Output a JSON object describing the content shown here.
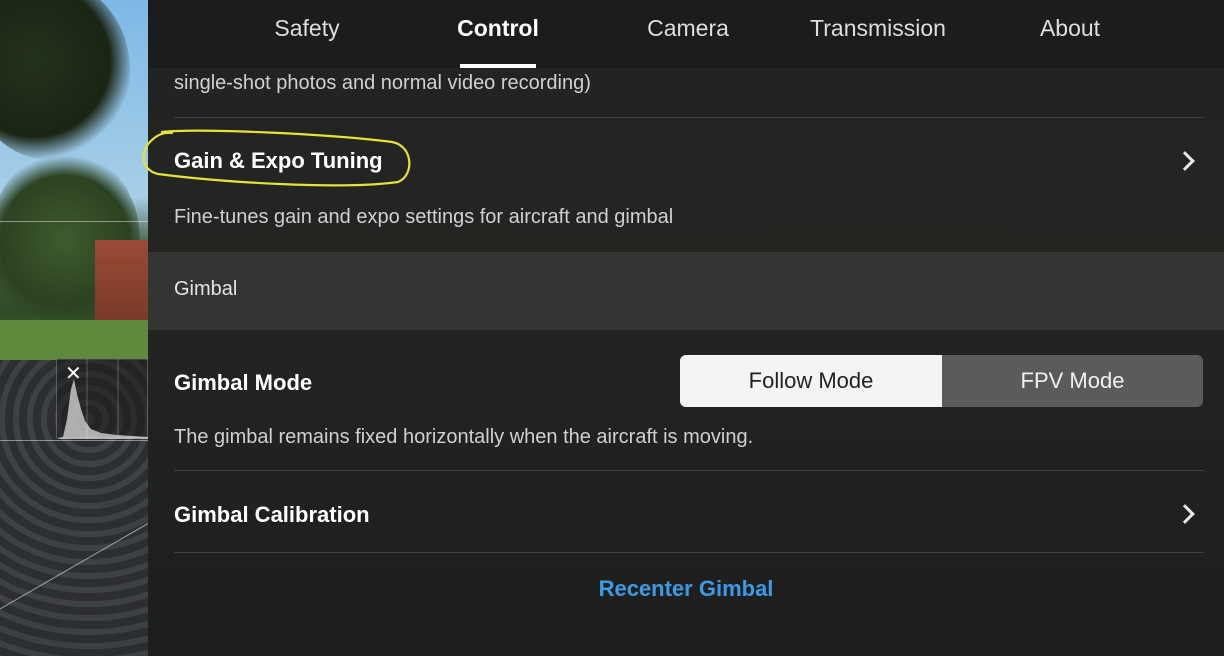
{
  "tabs": [
    {
      "label": "Safety",
      "active": false
    },
    {
      "label": "Control",
      "active": true
    },
    {
      "label": "Camera",
      "active": false
    },
    {
      "label": "Transmission",
      "active": false
    },
    {
      "label": "About",
      "active": false
    }
  ],
  "photo_note": "single-shot photos and normal video recording)",
  "gain_expo": {
    "title": "Gain & Expo Tuning",
    "description": "Fine-tunes gain and expo settings for aircraft and gimbal",
    "icon": "chevron-right-icon"
  },
  "gimbal_section": {
    "label": "Gimbal"
  },
  "gimbal_mode": {
    "title": "Gimbal Mode",
    "options": [
      "Follow Mode",
      "FPV Mode"
    ],
    "selected": "Follow Mode",
    "description": "The gimbal remains fixed horizontally when the aircraft is moving."
  },
  "gimbal_calibration": {
    "title": "Gimbal Calibration",
    "icon": "chevron-right-icon"
  },
  "recenter": {
    "label": "Recenter Gimbal"
  },
  "histogram": {
    "close_glyph": "✕"
  },
  "colors": {
    "accent": "#3b9be8",
    "annotation": "#e6e23a"
  }
}
